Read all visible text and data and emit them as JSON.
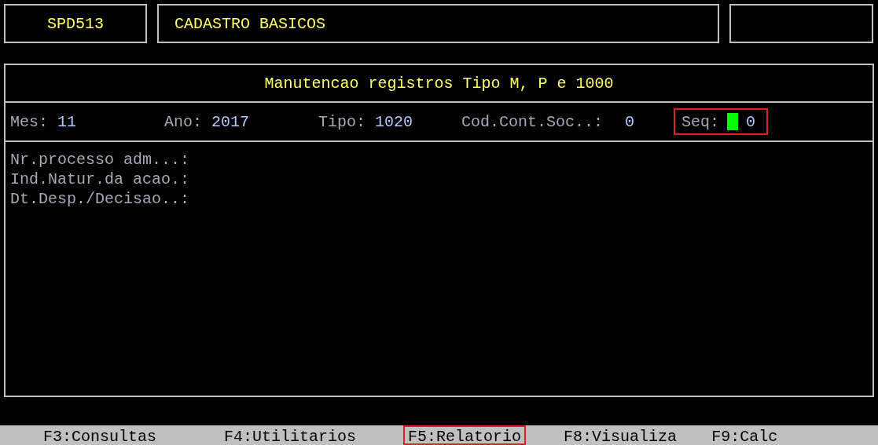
{
  "header": {
    "program": "SPD513",
    "title": "CADASTRO BASICOS"
  },
  "panel": {
    "title": "Manutencao registros Tipo M, P e 1000",
    "fields": [
      {
        "label": "Mes:",
        "value": "11",
        "highlighted": false,
        "cursor": false
      },
      {
        "label": "Ano:",
        "value": "2017",
        "highlighted": false,
        "cursor": false
      },
      {
        "label": "Tipo:",
        "value": "1020",
        "highlighted": false,
        "cursor": false
      },
      {
        "label": "Cod.Cont.Soc..:",
        "value": "0",
        "highlighted": false,
        "cursor": false
      },
      {
        "label": "Seq:",
        "value": "0",
        "highlighted": true,
        "cursor": true
      }
    ],
    "form_lines": [
      "Nr.processo adm...:",
      "Ind.Natur.da acao.:",
      "Dt.Desp./Decisao..:"
    ]
  },
  "function_keys": [
    {
      "label": "F3:Consultas",
      "highlighted": false
    },
    {
      "label": "F4:Utilitarios",
      "highlighted": false
    },
    {
      "label": "F5:Relatorio",
      "highlighted": true
    },
    {
      "label": "F8:Visualiza",
      "highlighted": false
    },
    {
      "label": "F9:Calc",
      "highlighted": false
    }
  ]
}
